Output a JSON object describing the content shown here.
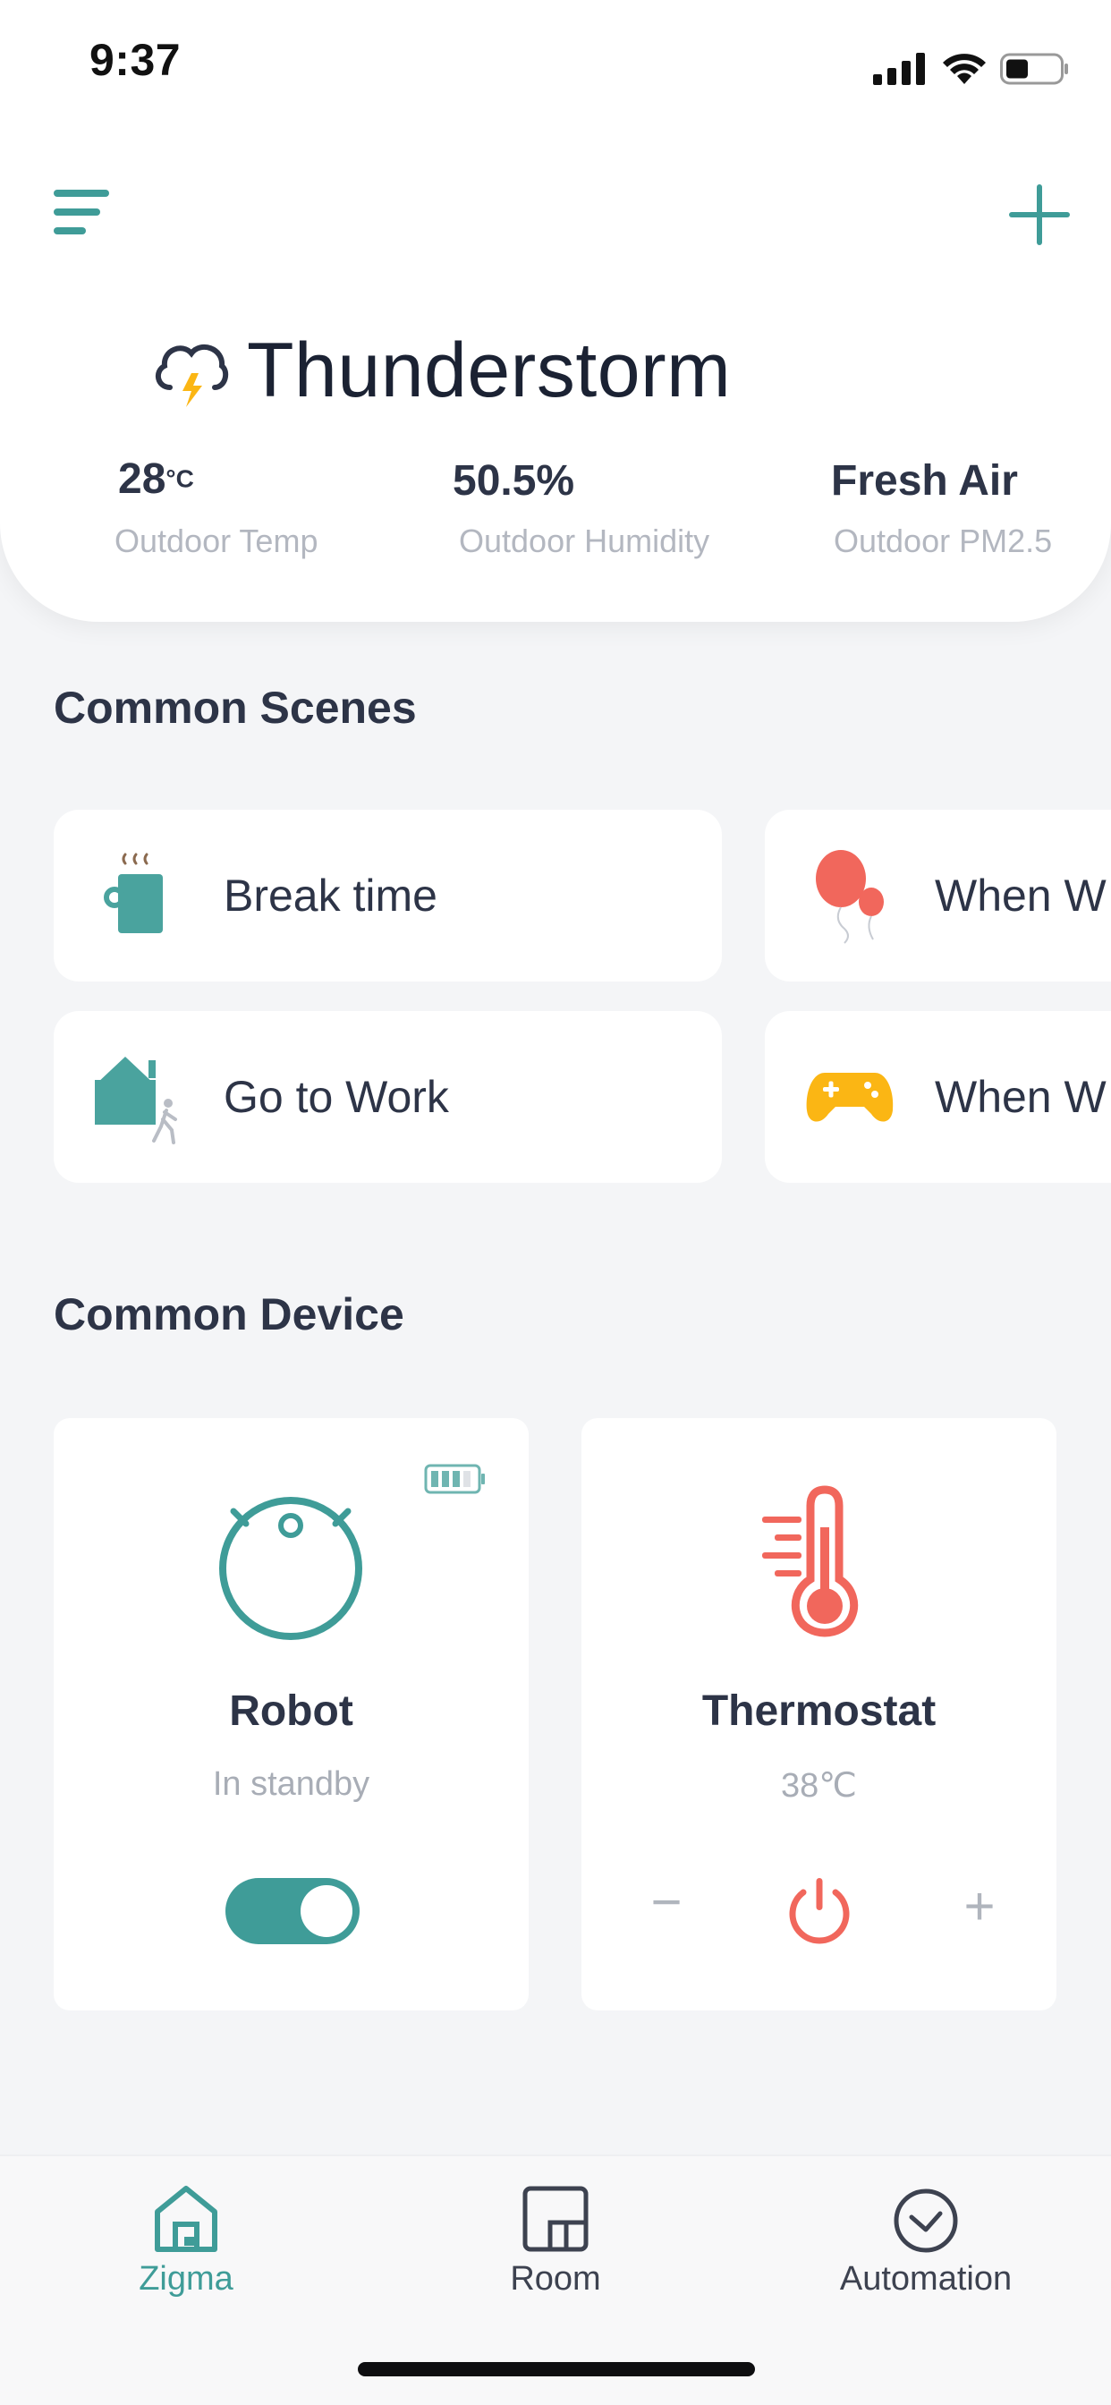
{
  "status_bar": {
    "time": "9:37"
  },
  "weather": {
    "condition": "Thunderstorm",
    "metrics": [
      {
        "value": "28",
        "unit": "°C",
        "label": "Outdoor Temp"
      },
      {
        "value": "50.5%",
        "label": "Outdoor Humidity"
      },
      {
        "value": "Fresh Air",
        "label": "Outdoor PM2.5"
      }
    ]
  },
  "scenes": {
    "title": "Common Scenes",
    "items": [
      {
        "label": "Break time",
        "icon": "coffee-mug-icon"
      },
      {
        "label": "When W",
        "icon": "balloons-icon"
      },
      {
        "label": "Go to Work",
        "icon": "house-walking-icon"
      },
      {
        "label": "When W",
        "icon": "gamepad-icon"
      }
    ]
  },
  "devices": {
    "title": "Common Device",
    "robot": {
      "name": "Robot",
      "status": "In standby",
      "toggle_on": true,
      "battery_level": 0.75
    },
    "thermostat": {
      "name": "Thermostat",
      "temp": "38℃",
      "minus_label": "−",
      "plus_label": "+"
    }
  },
  "tabs": [
    {
      "label": "Zigma",
      "active": true
    },
    {
      "label": "Room",
      "active": false
    },
    {
      "label": "Automation",
      "active": false
    }
  ],
  "colors": {
    "accent": "#3f9c98",
    "coral": "#f1675c",
    "amber": "#fbb614"
  }
}
